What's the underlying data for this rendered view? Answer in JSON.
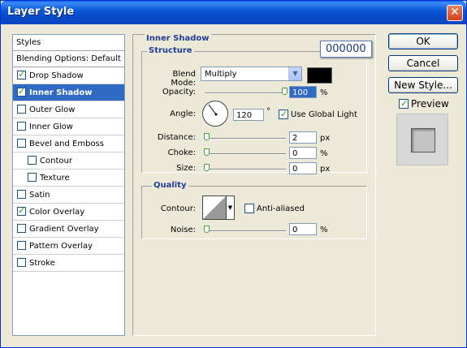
{
  "window": {
    "title": "Layer Style"
  },
  "styles": {
    "header": "Styles",
    "blending_default": "Blending Options: Default",
    "items": [
      {
        "label": "Drop Shadow",
        "checked": true,
        "selected": false,
        "sub": false
      },
      {
        "label": "Inner Shadow",
        "checked": true,
        "selected": true,
        "sub": false
      },
      {
        "label": "Outer Glow",
        "checked": false,
        "selected": false,
        "sub": false
      },
      {
        "label": "Inner Glow",
        "checked": false,
        "selected": false,
        "sub": false
      },
      {
        "label": "Bevel and Emboss",
        "checked": false,
        "selected": false,
        "sub": false
      },
      {
        "label": "Contour",
        "checked": false,
        "selected": false,
        "sub": true
      },
      {
        "label": "Texture",
        "checked": false,
        "selected": false,
        "sub": true
      },
      {
        "label": "Satin",
        "checked": false,
        "selected": false,
        "sub": false
      },
      {
        "label": "Color Overlay",
        "checked": true,
        "selected": false,
        "sub": false
      },
      {
        "label": "Gradient Overlay",
        "checked": false,
        "selected": false,
        "sub": false
      },
      {
        "label": "Pattern Overlay",
        "checked": false,
        "selected": false,
        "sub": false
      },
      {
        "label": "Stroke",
        "checked": false,
        "selected": false,
        "sub": false
      }
    ]
  },
  "inner_shadow": {
    "title": "Inner Shadow",
    "structure": {
      "title": "Structure",
      "blend_mode_label": "Blend Mode:",
      "blend_mode_value": "Multiply",
      "color_tooltip": "000000",
      "color_hex": "#000000",
      "opacity_label": "Opacity:",
      "opacity_value": "100",
      "opacity_unit": "%",
      "angle_label": "Angle:",
      "angle_value": "120",
      "angle_unit": "°",
      "use_global_light_label": "Use Global Light",
      "use_global_light_checked": true,
      "distance_label": "Distance:",
      "distance_value": "2",
      "distance_unit": "px",
      "choke_label": "Choke:",
      "choke_value": "0",
      "choke_unit": "%",
      "size_label": "Size:",
      "size_value": "0",
      "size_unit": "px"
    },
    "quality": {
      "title": "Quality",
      "contour_label": "Contour:",
      "anti_aliased_label": "Anti-aliased",
      "anti_aliased_checked": false,
      "noise_label": "Noise:",
      "noise_value": "0",
      "noise_unit": "%"
    }
  },
  "buttons": {
    "ok": "OK",
    "cancel": "Cancel",
    "new_style": "New Style...",
    "preview_label": "Preview",
    "preview_checked": true
  }
}
